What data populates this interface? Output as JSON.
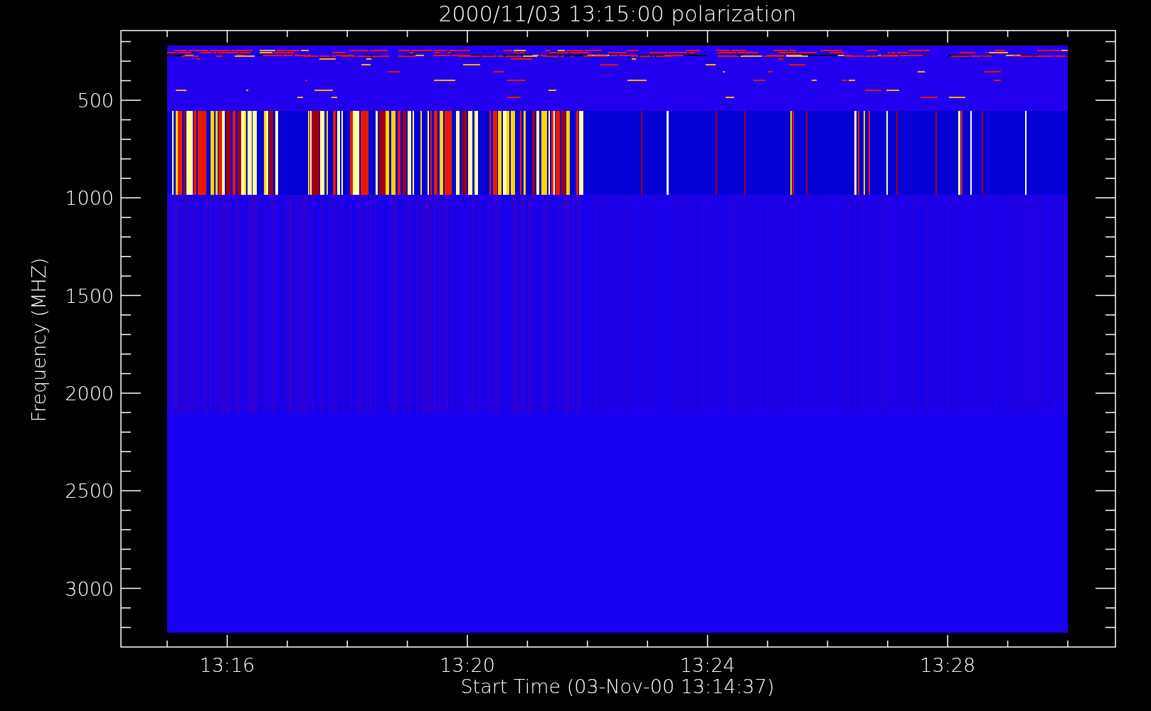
{
  "plot": {
    "title": "2000/11/03 13:15:00 polarization",
    "y_axis": {
      "label": "Frequency (MHZ)",
      "ticks": [
        "500",
        "1000",
        "1500",
        "2000",
        "2500",
        "3000"
      ]
    },
    "x_axis": {
      "label": "Start Time (03-Nov-00 13:14:37)",
      "ticks": [
        "13:16",
        "13:20",
        "13:24",
        "13:28"
      ]
    }
  }
}
